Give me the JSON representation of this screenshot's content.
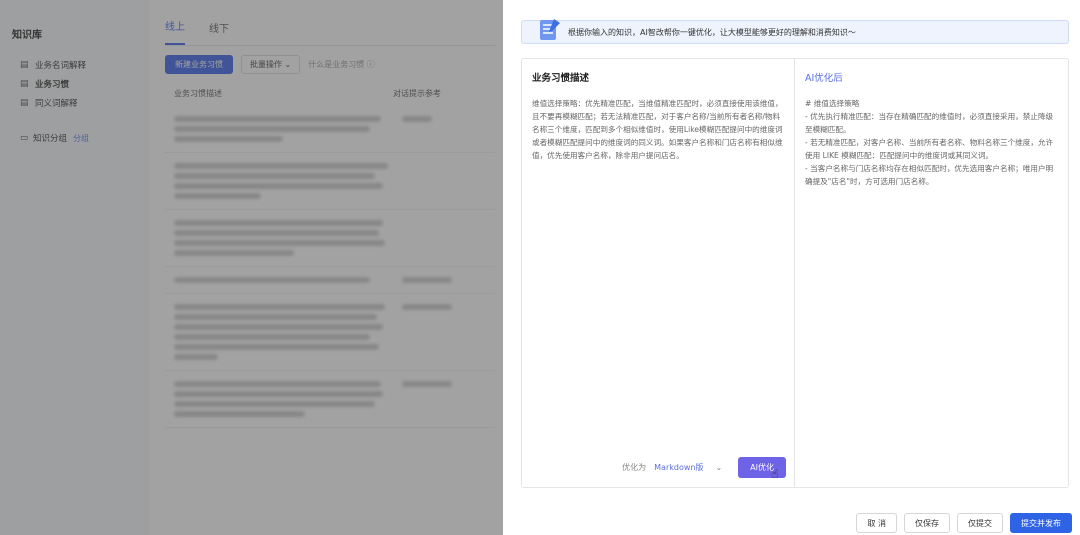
{
  "sidebar": {
    "title": "知识库",
    "items": [
      {
        "label": "业务名词解释",
        "icon": "doc-icon"
      },
      {
        "label": "业务习惯",
        "icon": "doc-icon"
      },
      {
        "label": "同义词解释",
        "icon": "doc-icon"
      }
    ],
    "group_label": "知识分组",
    "group_tag": "分组"
  },
  "main": {
    "tabs": [
      "线上",
      "线下"
    ],
    "new_button": "新建业务习惯",
    "batch_button": "批量操作",
    "help_link": "什么是业务习惯",
    "columns": [
      "业务习惯描述",
      "对话提示参考"
    ]
  },
  "drawer": {
    "banner_text": "根据你输入的知识，AI智改帮你一键优化，让大模型能够更好的理解和消费知识～",
    "left_title": "业务习惯描述",
    "left_body": "维值选择策略：优先精准匹配，当维值精准匹配时，必须直接使用该维值，且不要再模糊匹配；若无法精准匹配，对于客户名称/当前所有者名称/物料名称三个维度，匹配到多个相似维值时，使用Like模糊匹配提问中的维度词或者模糊匹配提问中的维度词的同义词。如果客户名称和门店名称有相似维值，优先使用客户名称，除非用户提问店名。",
    "right_title": "AI优化后",
    "right_body": "# 维值选择策略\n- 优先执行精准匹配：当存在精确匹配的维值时，必须直接采用，禁止降级至模糊匹配。\n- 若无精准匹配，对客户名称、当前所有者名称、物料名称三个维度，允许使用 LIKE 模糊匹配：匹配提问中的维度词或其同义词。\n- 当客户名称与门店名称均存在相似匹配时，优先选用客户名称；唯用户明确提及\"店名\"时，方可选用门店名称。",
    "optimize_label": "优化为",
    "optimize_format": "Markdown版",
    "ai_button": "AI优化"
  },
  "actions": {
    "cancel": "取 消",
    "save_only": "仅保存",
    "submit_only": "仅提交",
    "submit_publish": "提交并发布"
  }
}
